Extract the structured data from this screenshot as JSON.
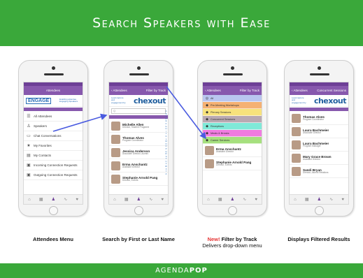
{
  "banner": {
    "title": "Search Speakers with Ease"
  },
  "footer": {
    "logo_a": "AGENDA",
    "logo_b": "POP"
  },
  "captions": {
    "c1": "Attendees Menu",
    "c2": "Search by First or Last Name",
    "c3_new": "New!",
    "c3_rest": " Filter by Track",
    "c3_sub": "Delivers drop-down menu",
    "c4": "Displays Filtered Results"
  },
  "phone1": {
    "nav_title": "Attendees",
    "logo": "ENGAGE",
    "logo_sub": "Enabling attendee Engaging Speakers",
    "menu": [
      {
        "icon": "list-icon",
        "glyph": "☰",
        "label": "All Attendees"
      },
      {
        "icon": "speaker-icon",
        "glyph": "♙",
        "label": "Speakers"
      },
      {
        "icon": "chat-icon",
        "glyph": "▭",
        "label": "Chat Conversations"
      },
      {
        "icon": "star-icon",
        "glyph": "★",
        "label": "My Favorites"
      },
      {
        "icon": "contacts-icon",
        "glyph": "▤",
        "label": "My Contacts"
      },
      {
        "icon": "incoming-icon",
        "glyph": "▣",
        "label": "Incoming Connection Requests"
      },
      {
        "icon": "outgoing-icon",
        "glyph": "▣",
        "label": "Outgoing Connection Requests"
      }
    ]
  },
  "phone2": {
    "nav_back": "‹ Attendees",
    "nav_right": "Filter by Track",
    "chex_sub": "Lead capture and engagement by",
    "chexout": "chexout",
    "search_placeholder": "Q",
    "people": [
      {
        "name": "Michelle Allen",
        "role": "Director, Student Programs"
      },
      {
        "name": "Thomas Alves",
        "role": "Program Coordinator"
      },
      {
        "name": "Jessica Anderson",
        "role": "Associate Director, Alumni"
      },
      {
        "name": "Erma Anschantz",
        "role": "Assistant Director"
      },
      {
        "name": "Stephanie Arnold Pang",
        "role": "Director, Events"
      }
    ]
  },
  "phone3": {
    "nav_back": "‹ Attendees",
    "nav_right": "Filter by Track",
    "tracks": [
      {
        "icon": "all-icon",
        "glyph": "◎",
        "label": "All",
        "color": "#b9c6ef"
      },
      {
        "icon": "workshop-icon",
        "glyph": "◆",
        "label": "Pre-Meeting Workshops",
        "color": "#f5b173"
      },
      {
        "icon": "plenary-icon",
        "glyph": "◆",
        "label": "Plenary Sessions",
        "color": "#f7e27c"
      },
      {
        "icon": "concurrent-icon",
        "glyph": "◆",
        "label": "Concurrent Sessions",
        "color": "#b9a9b2"
      },
      {
        "icon": "reception-icon",
        "glyph": "◆",
        "label": "Receptions",
        "color": "#7fe9d8"
      },
      {
        "icon": "meals-icon",
        "glyph": "◆",
        "label": "Meals & Breaks",
        "color": "#f07ce0"
      },
      {
        "icon": "career-icon",
        "glyph": "◆",
        "label": "Career Services",
        "color": "#a6e07e"
      }
    ],
    "people": [
      {
        "name": "Erma Anschantz",
        "role": "Assistant Director"
      },
      {
        "name": "Stephanie Arnold Pang",
        "role": "Director, Events"
      }
    ]
  },
  "phone4": {
    "nav_back": "‹ Attendees",
    "nav_right": "Concurrent Sessions",
    "chex_sub": "Lead capture and engagement by",
    "chexout": "chexout",
    "people": [
      {
        "name": "Thomas Alves",
        "role": "Program Coordinator"
      },
      {
        "name": "Laura Bachmeier",
        "role": "Associate Director"
      },
      {
        "name": "Laura Bachmeier",
        "role": "Program Manager"
      },
      {
        "name": "Mary Grace Brown",
        "role": "Assistant Director"
      },
      {
        "name": "Sandi Bryan",
        "role": "Director, Alumni Relations"
      }
    ]
  },
  "tabs": [
    {
      "icon": "home-icon",
      "glyph": "⌂"
    },
    {
      "icon": "agenda-icon",
      "glyph": "▦"
    },
    {
      "icon": "attendees-icon",
      "glyph": "♟"
    },
    {
      "icon": "activity-icon",
      "glyph": "∿"
    },
    {
      "icon": "more-icon",
      "glyph": "♥"
    }
  ],
  "alpha": "ABCDEFGHIJKLMNOPQRSTUVWXYZ",
  "colors": {
    "brand_green": "#3aa83a",
    "purple": "#8758ad",
    "arrow_blue": "#4a5be0",
    "new_red": "#e53333"
  }
}
